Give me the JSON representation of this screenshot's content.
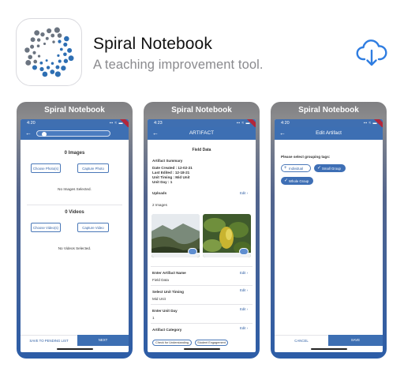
{
  "app": {
    "name": "Spiral Notebook",
    "subtitle": "A teaching improvement tool.",
    "download_icon": "cloud-download-icon"
  },
  "screens": [
    {
      "caption": "Spiral Notebook",
      "status_time": "4:20",
      "images_heading": "0 Images",
      "choose_photos": "Choose Photo(s)",
      "capture_photo": "Capture Photo",
      "no_images": "No Images Selected.",
      "videos_heading": "0 Videos",
      "choose_videos": "Choose Video(s)",
      "capture_video": "Capture Video",
      "no_videos": "No Videos Selected.",
      "save_list": "SAVE TO PENDING LIST",
      "next": "NEXT",
      "progress": 0.05
    },
    {
      "caption": "Spiral Notebook",
      "status_time": "4:23",
      "title": "ARTIFACT",
      "field_data": "Field Data",
      "summary_heading": "Artifact Summary",
      "date_created": "Date Created : 12-02-21",
      "last_edited": "Last Edited : 12-18-21",
      "unit_timing": "Unit Timing : Mid Unit",
      "unit_day": "Unit Day : 1",
      "uploads": "Uploads",
      "edit": "Edit",
      "images_count": "2 Images",
      "enter_name": "Enter Artifact Name",
      "name_value": "Field Data",
      "select_timing": "Select Unit Timing",
      "timing_value": "Mid Unit",
      "enter_day": "Enter Unit Day",
      "day_value": "1",
      "category": "Artifact Category",
      "check_understanding": "Check for Understanding",
      "student_engagement": "Student Engagement"
    },
    {
      "caption": "Spiral Notebook",
      "status_time": "4:20",
      "title": "Edit Artifact",
      "prompt": "Please select grouping tags:",
      "tags": [
        {
          "label": "Individual",
          "selected": false
        },
        {
          "label": "Small Group",
          "selected": true
        },
        {
          "label": "Whole Group",
          "selected": true
        }
      ],
      "cancel": "CANCEL",
      "save": "SAVE"
    }
  ],
  "colors": {
    "accent": "#3d6fb3",
    "ribbon": "#b3263a",
    "dot_blue": "#2e6fb3",
    "dot_gray": "#6b7480"
  }
}
